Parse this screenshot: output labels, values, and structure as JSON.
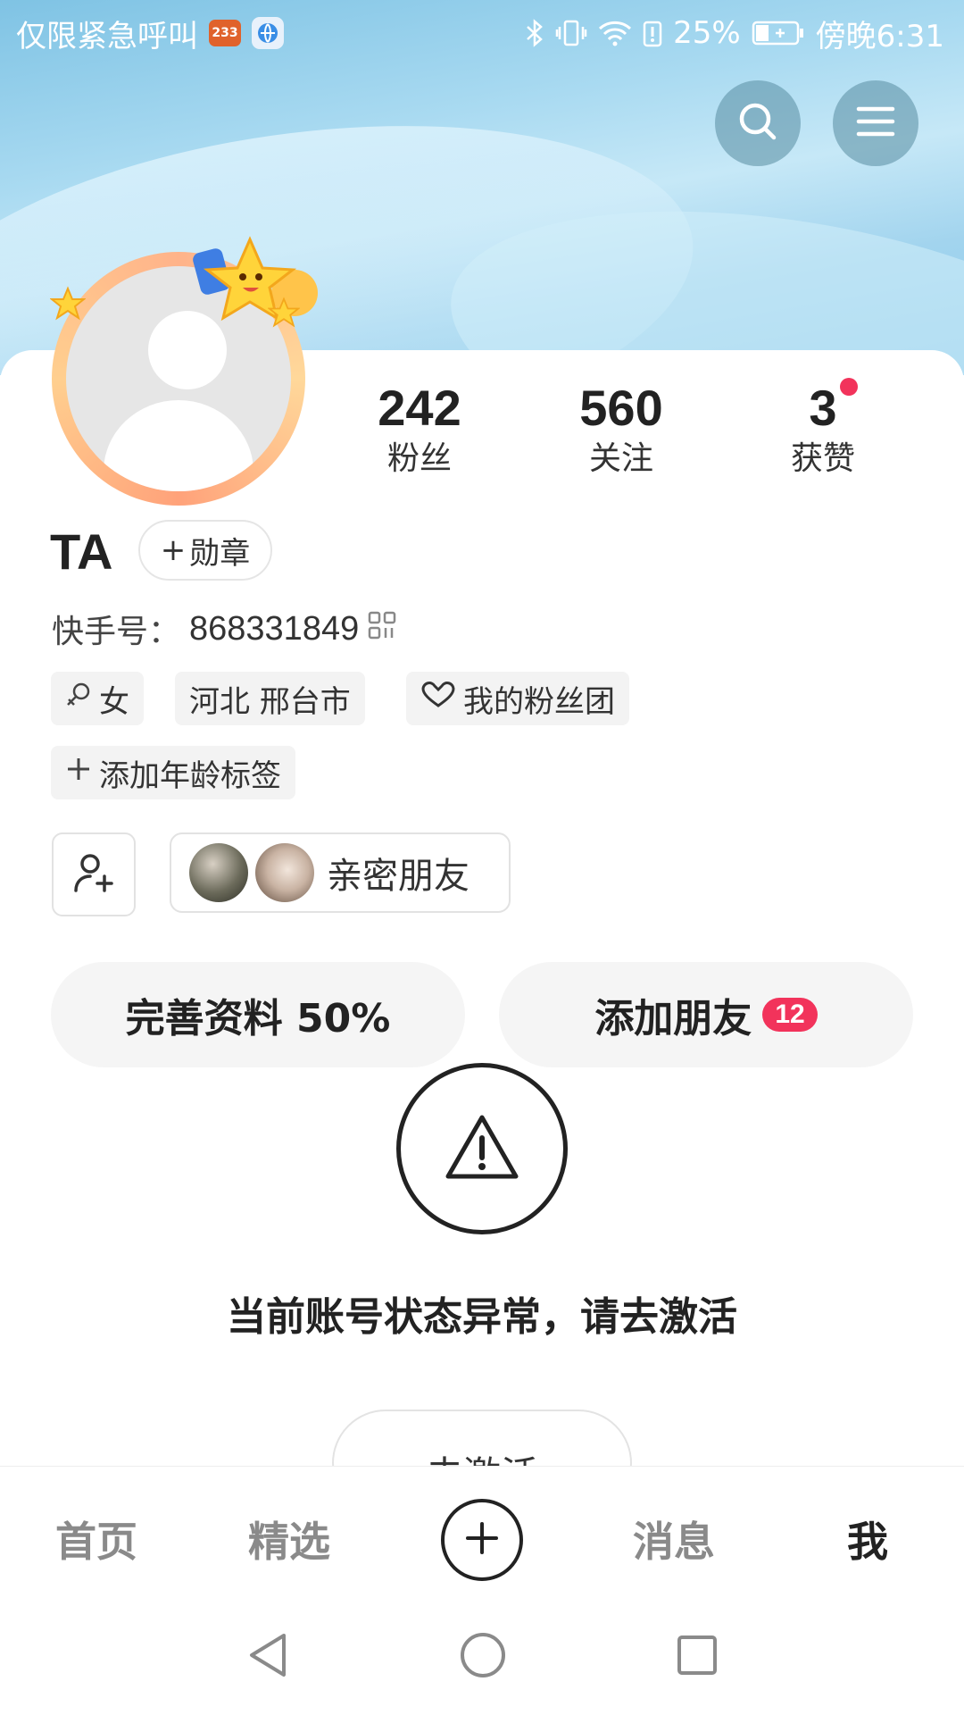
{
  "status_bar": {
    "carrier_text": "仅限紧急呼叫",
    "app_badge": "233",
    "battery_pct": "25%",
    "time": "傍晚6:31",
    "icons": [
      "bluetooth-icon",
      "vibrate-icon",
      "wifi-icon",
      "battery-alert-icon",
      "battery-icon"
    ]
  },
  "header": {
    "search_icon": "search-icon",
    "menu_icon": "menu-icon"
  },
  "profile": {
    "name": "TA",
    "medal_label": "勋章",
    "kuaishou_id_label": "快手号：",
    "kuaishou_id": "868331849",
    "stats": [
      {
        "value": "242",
        "label": "粉丝"
      },
      {
        "value": "560",
        "label": "关注"
      },
      {
        "value": "3",
        "label": "获赞"
      }
    ],
    "tags": {
      "gender": "女",
      "location": "河北 邢台市",
      "fan_group": "我的粉丝团",
      "add_age": "添加年龄标签"
    },
    "close_friends_label": "亲密朋友"
  },
  "actions": {
    "complete_profile": "完善资料 50%",
    "complete_profile_progress": 50,
    "add_friends": "添加朋友",
    "add_friends_badge": "12"
  },
  "alert": {
    "message": "当前账号状态异常，请去激活",
    "activate_button": "去激活"
  },
  "tabs": [
    {
      "label": "首页",
      "active": false
    },
    {
      "label": "精选",
      "active": false
    },
    {
      "label": "消息",
      "active": false
    },
    {
      "label": "我",
      "active": true
    }
  ],
  "colors": {
    "accent_red": "#f2335b",
    "sky_blue": "#a9daf1"
  }
}
